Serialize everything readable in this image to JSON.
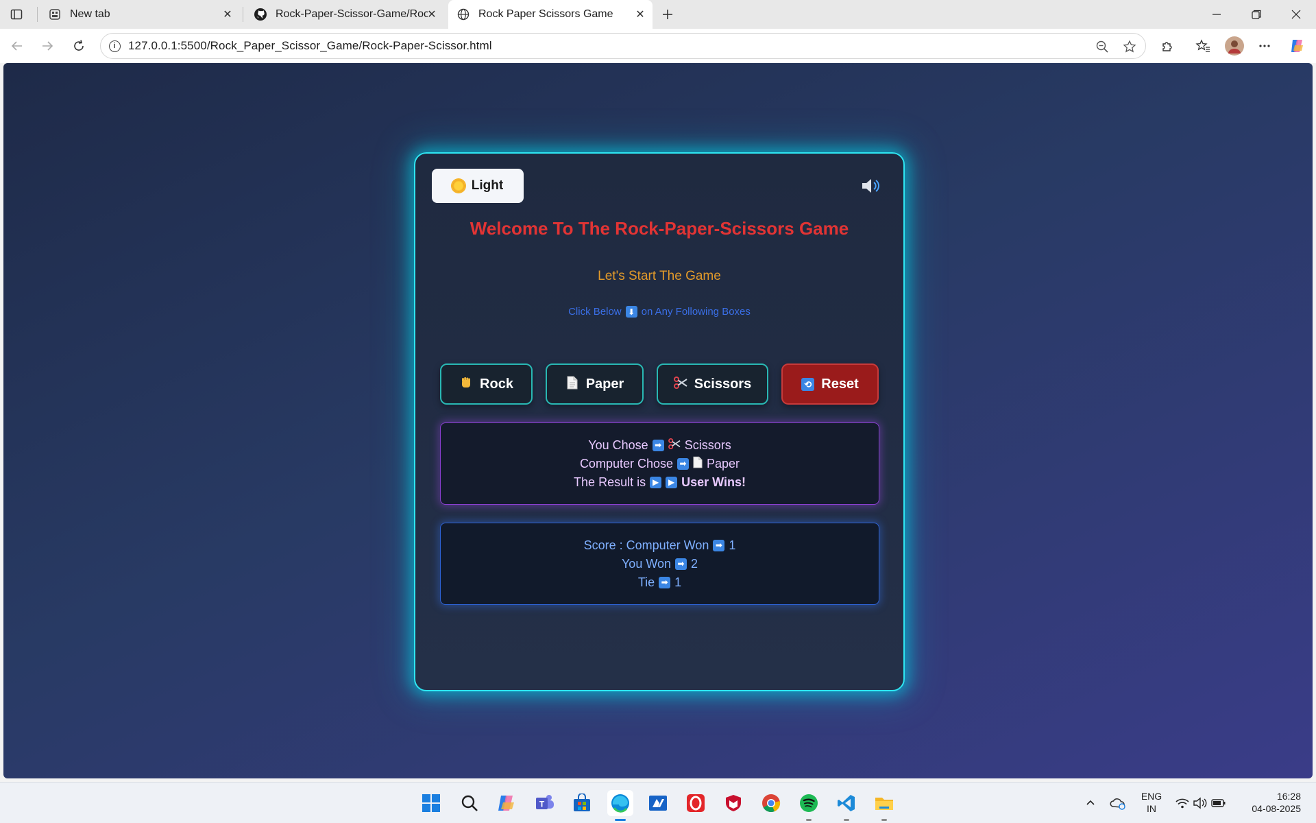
{
  "browser": {
    "tabs": [
      {
        "title": "New tab",
        "active": false
      },
      {
        "title": "Rock-Paper-Scissor-Game/Rock-P",
        "active": false
      },
      {
        "title": "Rock Paper Scissors Game",
        "active": true
      }
    ],
    "url": "127.0.0.1:5500/Rock_Paper_Scissor_Game/Rock-Paper-Scissor.html"
  },
  "game": {
    "theme_label": "Light",
    "title": "Welcome To The Rock-Paper-Scissors Game",
    "subtitle": "Let's Start The Game",
    "hint_before": "Click Below",
    "hint_after": "on Any Following Boxes",
    "buttons": {
      "rock": "Rock",
      "paper": "Paper",
      "scissors": "Scissors",
      "reset": "Reset"
    },
    "result": {
      "you_label": "You Chose",
      "you_choice": "Scissors",
      "computer_label": "Computer Chose",
      "computer_choice": "Paper",
      "result_label": "The Result is",
      "result_value": "User Wins!"
    },
    "score": {
      "computer_label": "Score : Computer Won",
      "computer_value": "1",
      "you_label": "You Won",
      "you_value": "2",
      "tie_label": "Tie",
      "tie_value": "1"
    }
  },
  "taskbar": {
    "lang_top": "ENG",
    "lang_bottom": "IN",
    "time": "16:28",
    "date": "04-08-2025"
  },
  "colors": {
    "card_border": "#2ee6f2",
    "title": "#e23434",
    "subtitle": "#e29a2a",
    "hint": "#3a6fe6",
    "reset_bg": "#9a1b1b",
    "result_border": "#8a3fd0",
    "score_border": "#2d63d6"
  }
}
